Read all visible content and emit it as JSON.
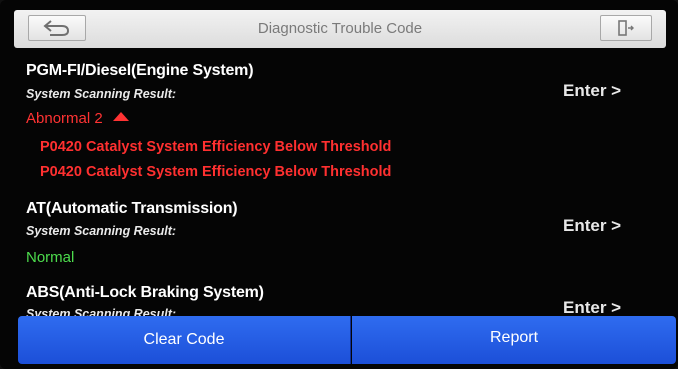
{
  "header": {
    "title": "Diagnostic Trouble Code"
  },
  "systems": [
    {
      "name": "PGM-FI/Diesel(Engine System)",
      "scan_label": "System Scanning Result:",
      "status": "Abnormal 2",
      "enter_label": "Enter >",
      "codes": [
        "P0420 Catalyst System Efficiency Below Threshold",
        "P0420 Catalyst System Efficiency Below Threshold"
      ]
    },
    {
      "name": "AT(Automatic Transmission)",
      "scan_label": "System Scanning Result:",
      "status": "Normal",
      "enter_label": "Enter >"
    },
    {
      "name": "ABS(Anti-Lock Braking System)",
      "scan_label": "System Scanning Result:",
      "enter_label": "Enter >"
    }
  ],
  "footer": {
    "clear_label": "Clear Code",
    "report_label": "Report"
  },
  "colors": {
    "abnormal": "#ff3333",
    "normal": "#4ddc4d",
    "button_blue": "#2462e8"
  },
  "icons": {
    "back": "back-arrow-icon",
    "exit": "exit-door-icon",
    "expand": "triangle-up-icon"
  }
}
